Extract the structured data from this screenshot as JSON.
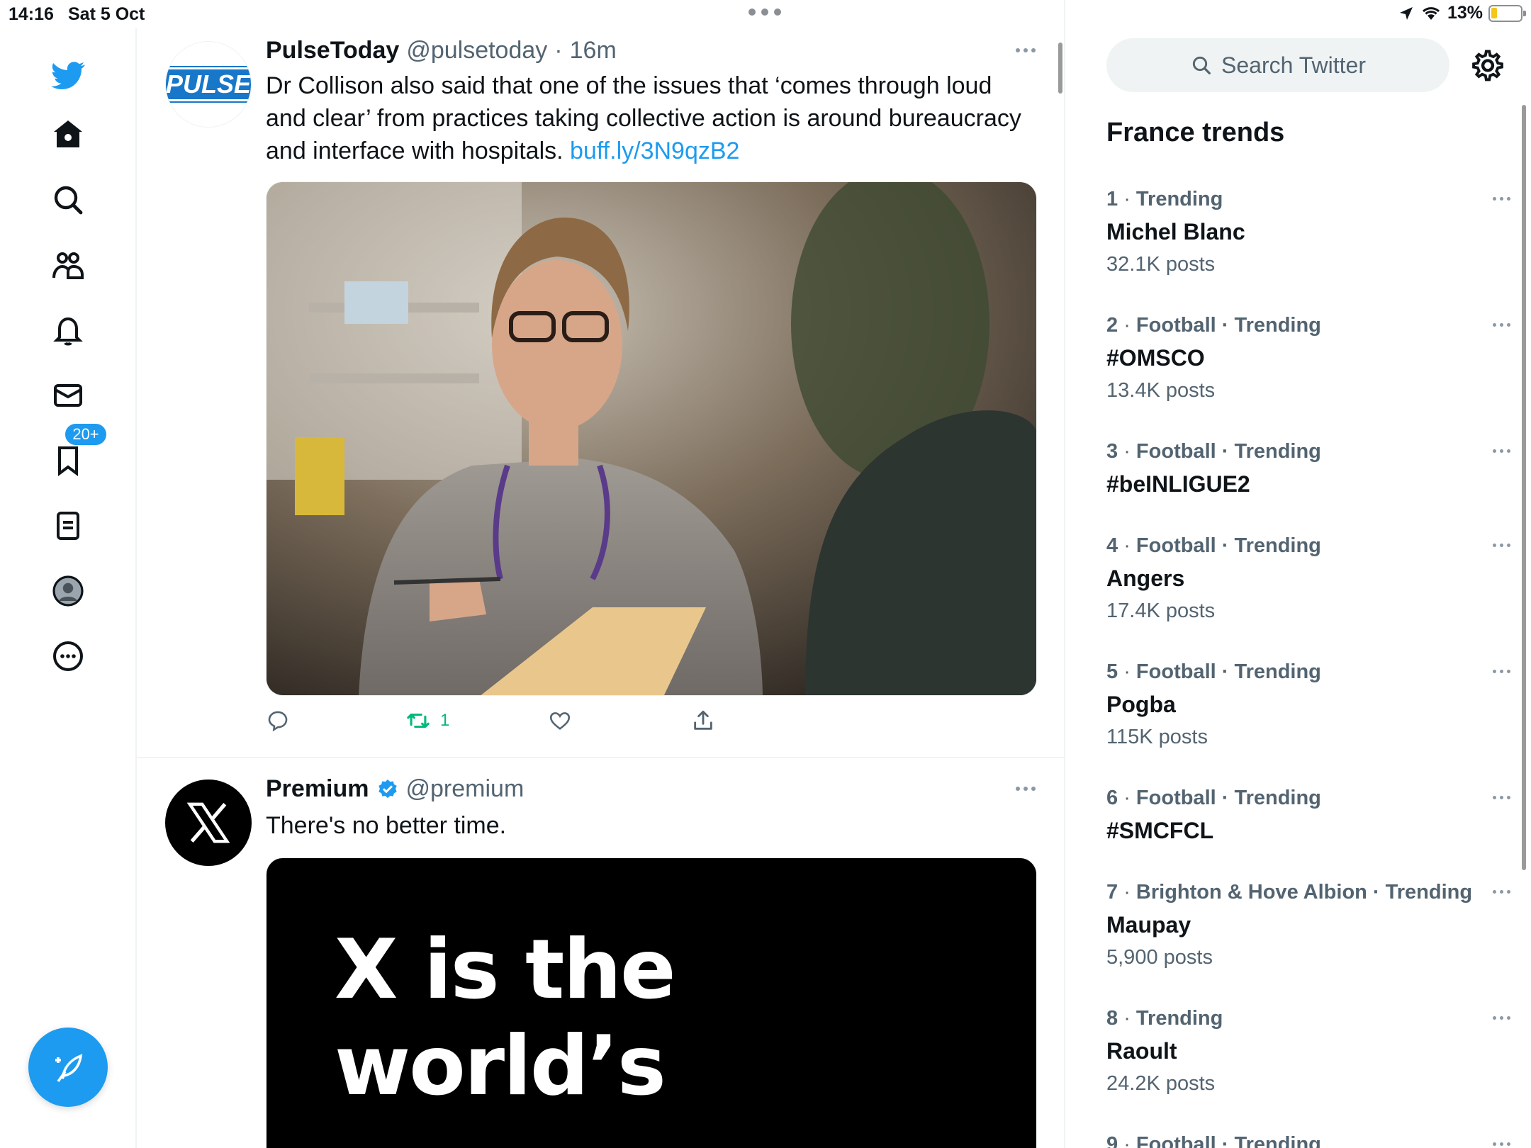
{
  "status_bar": {
    "time": "14:16",
    "date": "Sat 5 Oct",
    "battery": "13%"
  },
  "nav": {
    "items": [
      "twitter-logo",
      "home",
      "explore",
      "communities",
      "notifications",
      "messages",
      "bookmarks",
      "lists",
      "profile",
      "more"
    ],
    "notification_badge": "20+"
  },
  "feed": {
    "tweets": [
      {
        "avatar_text": "PULSE",
        "name": "PulseToday",
        "handle": "@pulsetoday",
        "separator": "·",
        "time": "16m",
        "text": "Dr Collison also said that one of the issues that ‘comes through loud and clear’ from practices taking collective action is around bureaucracy and interface with hospitals.",
        "link": "buff.ly/3N9qzB2",
        "retweets": "1"
      },
      {
        "name": "Premium",
        "handle": "@premium",
        "verified": true,
        "text": "There's no better time.",
        "media_text_line1": "X is the",
        "media_text_line2": "world’s"
      }
    ]
  },
  "sidebar": {
    "search_placeholder": "Search Twitter",
    "trends_title": "France trends",
    "trends": [
      {
        "rank": "1",
        "category": "Trending",
        "name": "Michel Blanc",
        "count": "32.1K posts"
      },
      {
        "rank": "2",
        "category": "Football · Trending",
        "name": "#OMSCO",
        "count": "13.4K posts"
      },
      {
        "rank": "3",
        "category": "Football · Trending",
        "name": "#beINLIGUE2",
        "count": ""
      },
      {
        "rank": "4",
        "category": "Football · Trending",
        "name": "Angers",
        "count": "17.4K posts"
      },
      {
        "rank": "5",
        "category": "Football · Trending",
        "name": "Pogba",
        "count": "115K posts"
      },
      {
        "rank": "6",
        "category": "Football · Trending",
        "name": "#SMCFCL",
        "count": ""
      },
      {
        "rank": "7",
        "category": "Brighton & Hove Albion · Trending",
        "name": "Maupay",
        "count": "5,900 posts"
      },
      {
        "rank": "8",
        "category": "Trending",
        "name": "Raoult",
        "count": "24.2K posts"
      },
      {
        "rank": "9",
        "category": "Football · Trending",
        "name": "",
        "count": ""
      }
    ]
  },
  "colors": {
    "accent": "#1d9bf0",
    "retweet_green": "#00ba7c",
    "secondary_text": "#536471"
  }
}
